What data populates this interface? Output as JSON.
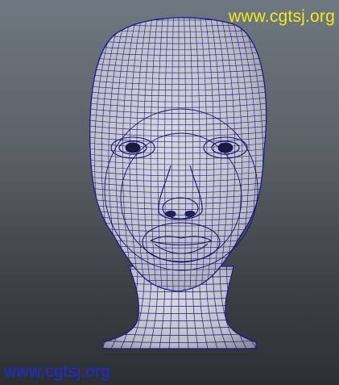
{
  "watermark": {
    "top_text": "www.cgtsj.org",
    "bottom_text": "www.cgtsj.org",
    "top_color": "#f2ea1a",
    "bottom_color": "#1d2bd6"
  },
  "viewport": {
    "background_top": "#6f7780",
    "background_bottom": "#2c2f33"
  },
  "model": {
    "name": "head-wireframe-mesh",
    "surface_color": "#c9c9cf",
    "wire_color": "#1a1a8a"
  }
}
